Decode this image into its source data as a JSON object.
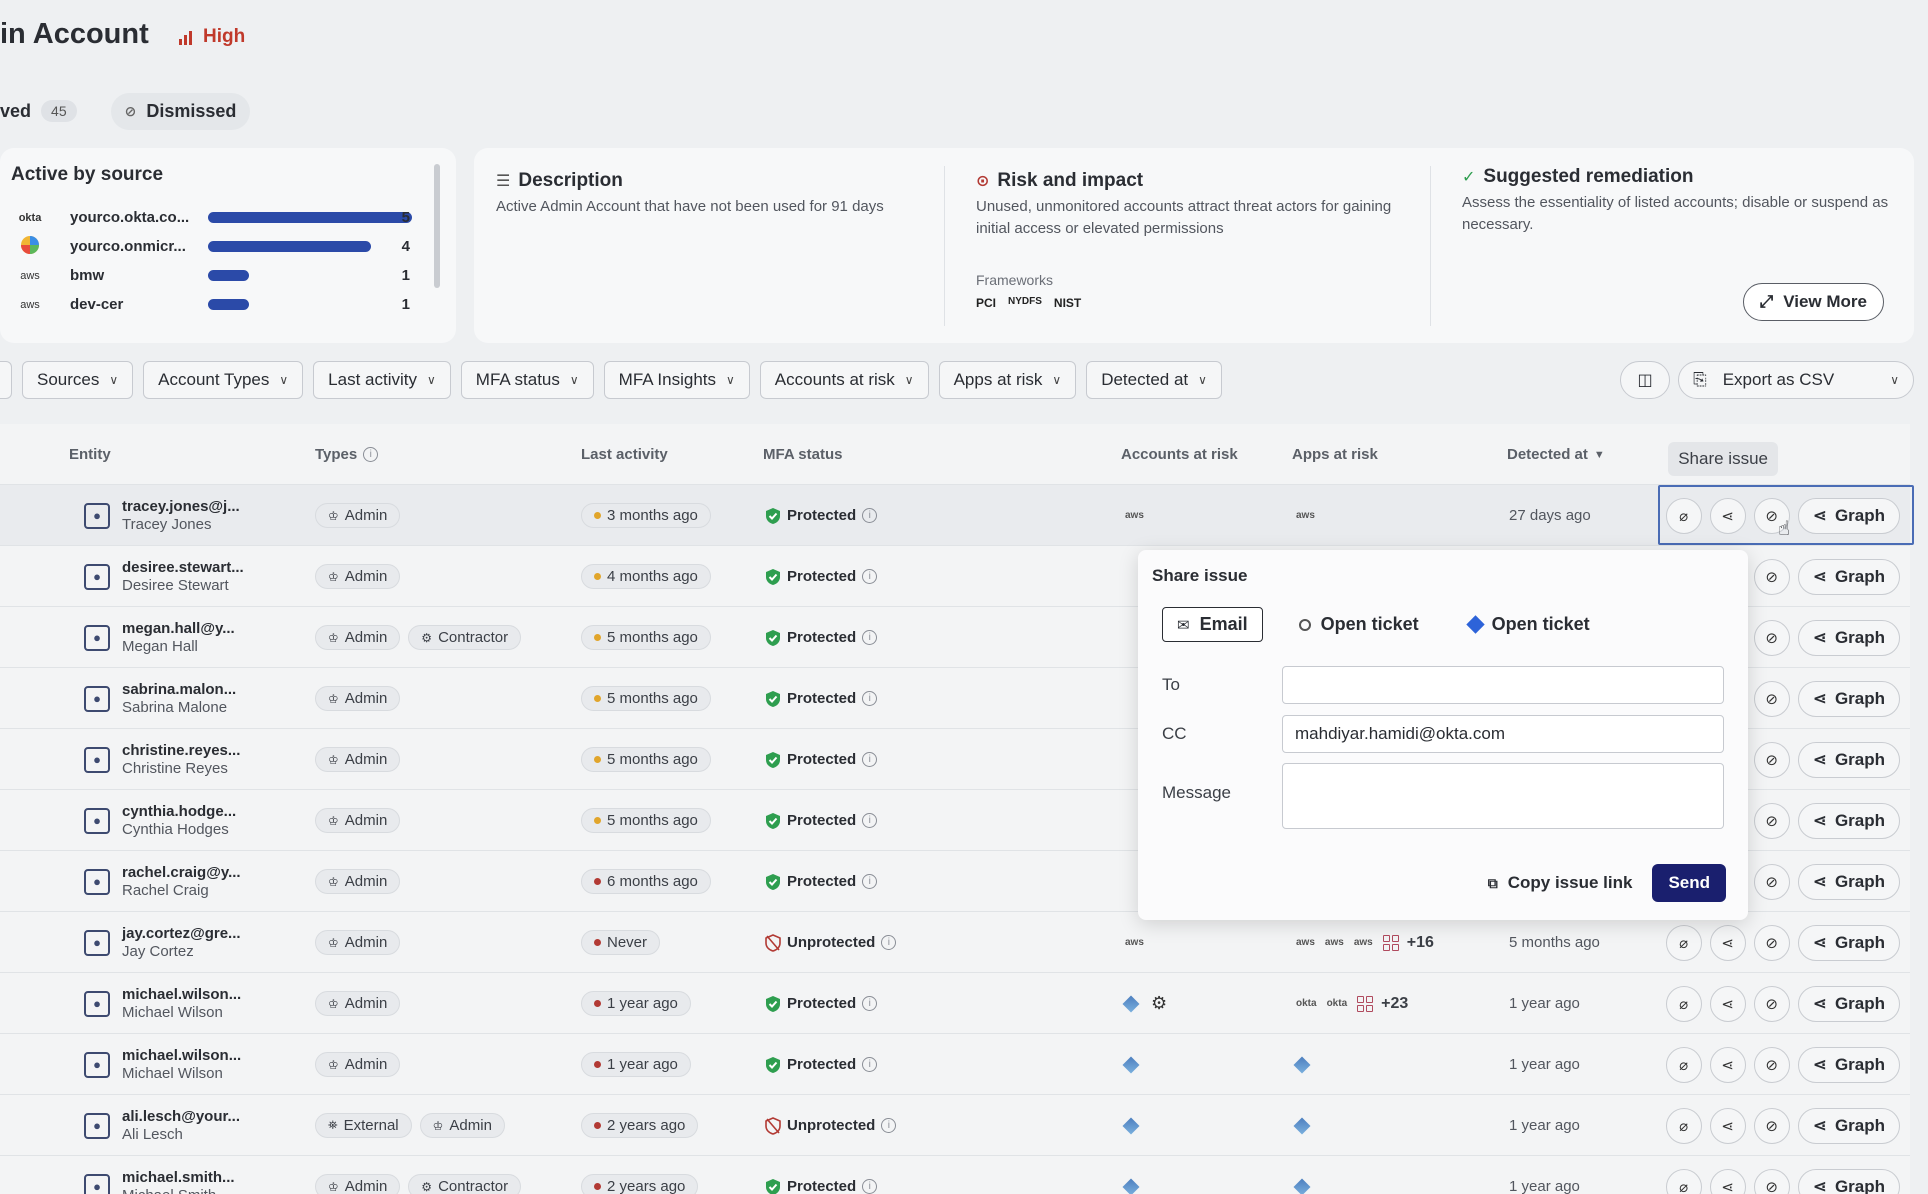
{
  "header": {
    "title": "in Account",
    "severity": "High"
  },
  "tabs": [
    {
      "label": "ved",
      "count": "45"
    },
    {
      "label": "Dismissed"
    }
  ],
  "sources": {
    "title": "Active by source",
    "items": [
      {
        "logo": "okta",
        "name": "yourco.okta.co...",
        "count": "5",
        "ratio": 1.0
      },
      {
        "logo": "ms",
        "name": "yourco.onmicr...",
        "count": "4",
        "ratio": 0.8
      },
      {
        "logo": "aws",
        "name": "bmw",
        "count": "1",
        "ratio": 0.2
      },
      {
        "logo": "aws",
        "name": "dev-cer",
        "count": "1",
        "ratio": 0.2
      }
    ]
  },
  "info": {
    "description_title": "Description",
    "description": "Active Admin Account that have not been used for 91 days",
    "risk_title": "Risk and impact",
    "risk": "Unused, unmonitored accounts attract threat actors for gaining initial access or elevated permissions",
    "frameworks_label": "Frameworks",
    "frameworks": [
      "PCI",
      "NYDFS",
      "NIST"
    ],
    "remediation_title": "Suggested remediation",
    "remediation": "Assess the essentiality of listed accounts; disable or suspend as necessary.",
    "view_more": "View More"
  },
  "filters": [
    "Sources",
    "Account Types",
    "Last activity",
    "MFA status",
    "MFA Insights",
    "Accounts at risk",
    "Apps at risk",
    "Detected at"
  ],
  "export_label": "Export as CSV",
  "columns": {
    "entity": "Entity",
    "types": "Types",
    "last_activity": "Last activity",
    "mfa": "MFA status",
    "accounts": "Accounts at risk",
    "apps": "Apps at risk",
    "detected": "Detected at"
  },
  "tooltip": "Share issue",
  "rows": [
    {
      "email": "tracey.jones@j...",
      "name": "Tracey Jones",
      "types": [
        "Admin"
      ],
      "activity": "3 months ago",
      "dot": "y",
      "mfa": "Protected",
      "accounts": "aws",
      "apps": "aws",
      "detected": "27 days ago"
    },
    {
      "email": "desiree.stewart...",
      "name": "Desiree Stewart",
      "types": [
        "Admin"
      ],
      "activity": "4 months ago",
      "dot": "y",
      "mfa": "Protected"
    },
    {
      "email": "megan.hall@y...",
      "name": "Megan Hall",
      "types": [
        "Admin",
        "Contractor"
      ],
      "activity": "5 months ago",
      "dot": "y",
      "mfa": "Protected"
    },
    {
      "email": "sabrina.malon...",
      "name": "Sabrina Malone",
      "types": [
        "Admin"
      ],
      "activity": "5 months ago",
      "dot": "y",
      "mfa": "Protected"
    },
    {
      "email": "christine.reyes...",
      "name": "Christine Reyes",
      "types": [
        "Admin"
      ],
      "activity": "5 months ago",
      "dot": "y",
      "mfa": "Protected"
    },
    {
      "email": "cynthia.hodge...",
      "name": "Cynthia Hodges",
      "types": [
        "Admin"
      ],
      "activity": "5 months ago",
      "dot": "y",
      "mfa": "Protected"
    },
    {
      "email": "rachel.craig@y...",
      "name": "Rachel Craig",
      "types": [
        "Admin"
      ],
      "activity": "6 months ago",
      "dot": "r",
      "mfa": "Protected"
    },
    {
      "email": "jay.cortez@gre...",
      "name": "Jay Cortez",
      "types": [
        "Admin"
      ],
      "activity": "Never",
      "dot": "r",
      "mfa": "Unprotected",
      "accounts": "aws",
      "apps": "aws aws aws",
      "apps_more": "+16",
      "detected": "5 months ago"
    },
    {
      "email": "michael.wilson...",
      "name": "Michael Wilson",
      "types": [
        "Admin"
      ],
      "activity": "1 year ago",
      "dot": "r",
      "mfa": "Protected",
      "apps": "okta okta",
      "apps_more": "+23",
      "detected": "1 year ago"
    },
    {
      "email": "michael.wilson...",
      "name": "Michael Wilson",
      "types": [
        "Admin"
      ],
      "activity": "1 year ago",
      "dot": "r",
      "mfa": "Protected",
      "detected": "1 year ago"
    },
    {
      "email": "ali.lesch@your...",
      "name": "Ali Lesch",
      "types": [
        "External",
        "Admin"
      ],
      "activity": "2 years ago",
      "dot": "r",
      "mfa": "Unprotected",
      "detected": "1 year ago"
    },
    {
      "email": "michael.smith...",
      "name": "Michael Smith",
      "types": [
        "Admin",
        "Contractor"
      ],
      "activity": "2 years ago",
      "dot": "r",
      "mfa": "Protected",
      "detected": "1 year ago"
    }
  ],
  "graph_label": "Graph",
  "share": {
    "title": "Share issue",
    "tabs": [
      "Email",
      "Open ticket",
      "Open ticket"
    ],
    "to_label": "To",
    "to_value": "",
    "cc_label": "CC",
    "cc_value": "mahdiyar.hamidi@okta.com",
    "message_label": "Message",
    "copy_link": "Copy issue link",
    "send": "Send"
  },
  "colors": {
    "accent": "#2b4aa8",
    "send": "#1a1f6e",
    "high": "#c0392b",
    "protected": "#2e9e4f",
    "unprotected": "#b23a34"
  }
}
